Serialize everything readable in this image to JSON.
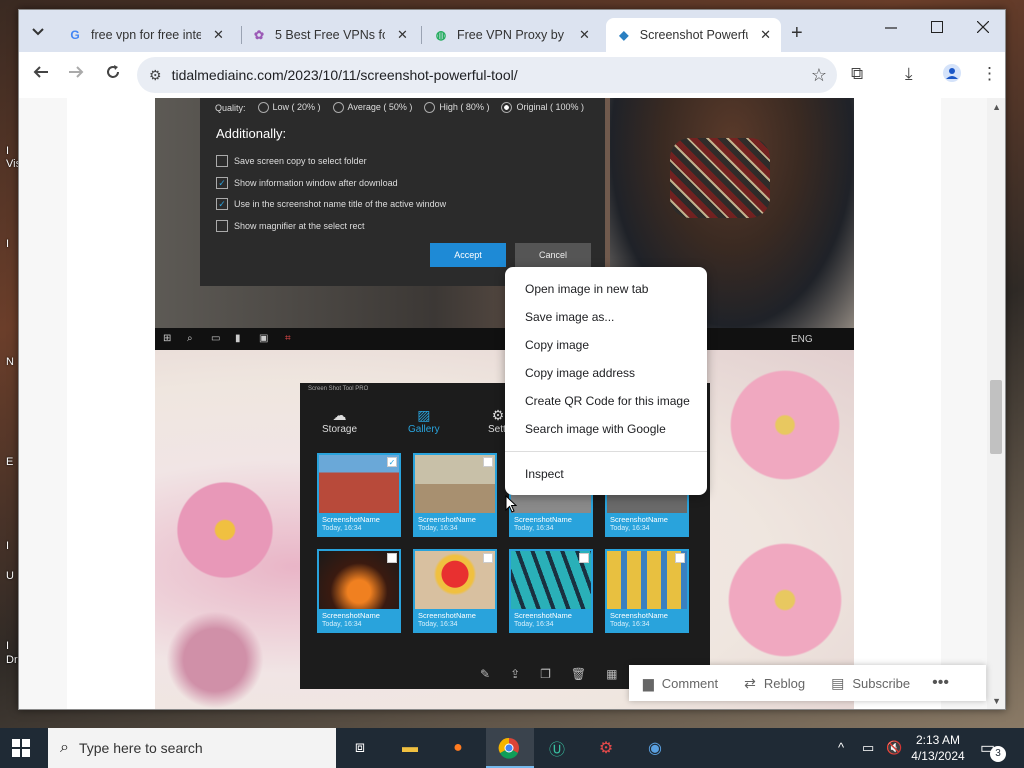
{
  "desktop": {
    "icon_labels": [
      "I",
      "Vis",
      "I",
      "N",
      "E",
      "I",
      "U",
      "I",
      "Dri"
    ]
  },
  "browser": {
    "tabs": [
      {
        "title": "free vpn for free inte",
        "favicon": "google-icon",
        "active": false
      },
      {
        "title": "5 Best Free VPNs for",
        "favicon": "vpn-icon",
        "active": false
      },
      {
        "title": "Free VPN Proxy by H",
        "favicon": "proxy-icon",
        "active": false
      },
      {
        "title": "Screenshot Powerful",
        "favicon": "screenshot-icon",
        "active": true
      }
    ],
    "url": "tidalmediainc.com/2023/10/11/screenshot-powerful-tool/"
  },
  "screenshot_dialog": {
    "quality_label": "Quality:",
    "quality_options": [
      "Low ( 20% )",
      "Average ( 50% )",
      "High ( 80% )",
      "Original ( 100% )"
    ],
    "quality_selected": "Original ( 100% )",
    "additionally_label": "Additionally:",
    "options": [
      {
        "label": "Save screen copy to select folder",
        "checked": false
      },
      {
        "label": "Show information window after download",
        "checked": true
      },
      {
        "label": "Use in the screenshot name title of the active window",
        "checked": true
      },
      {
        "label": "Show magnifier at the select rect",
        "checked": false
      }
    ],
    "accept_label": "Accept",
    "cancel_label": "Cancel",
    "mini_taskbar_lang": "ENG"
  },
  "gallery_app": {
    "title": "Screen Shot Tool PRO",
    "nav": [
      "Storage",
      "Gallery",
      "Setti"
    ],
    "thumbs": [
      {
        "name": "ScreenshotName",
        "date": "Today, 16:34",
        "checked": true
      },
      {
        "name": "ScreenshotName",
        "date": "Today, 16:34",
        "checked": false
      },
      {
        "name": "ScreenshotName",
        "date": "Today, 16:34",
        "checked": false
      },
      {
        "name": "ScreenshotName",
        "date": "Today, 16:34",
        "checked": false
      },
      {
        "name": "ScreenshotName",
        "date": "Today, 16:34",
        "checked": false
      },
      {
        "name": "ScreenshotName",
        "date": "Today, 16:34",
        "checked": false
      },
      {
        "name": "ScreenshotName",
        "date": "Today, 16:34",
        "checked": false
      },
      {
        "name": "ScreenshotName",
        "date": "Today, 16:34",
        "checked": false
      }
    ]
  },
  "context_menu": {
    "items": [
      "Open image in new tab",
      "Save image as...",
      "Copy image",
      "Copy image address",
      "Create QR Code for this image",
      "Search image with Google"
    ],
    "inspect": "Inspect"
  },
  "tumblr_bar": {
    "comment": "Comment",
    "reblog": "Reblog",
    "subscribe": "Subscribe",
    "more": "•••"
  },
  "taskbar": {
    "search_placeholder": "Type here to search",
    "time": "2:13 AM",
    "date": "4/13/2024",
    "notification_count": "3"
  },
  "colors": {
    "accent": "#1e8ad6",
    "gallery_tile": "#29a3dc",
    "taskbar": "#1f2a35",
    "tabbar": "#dce3f0"
  }
}
